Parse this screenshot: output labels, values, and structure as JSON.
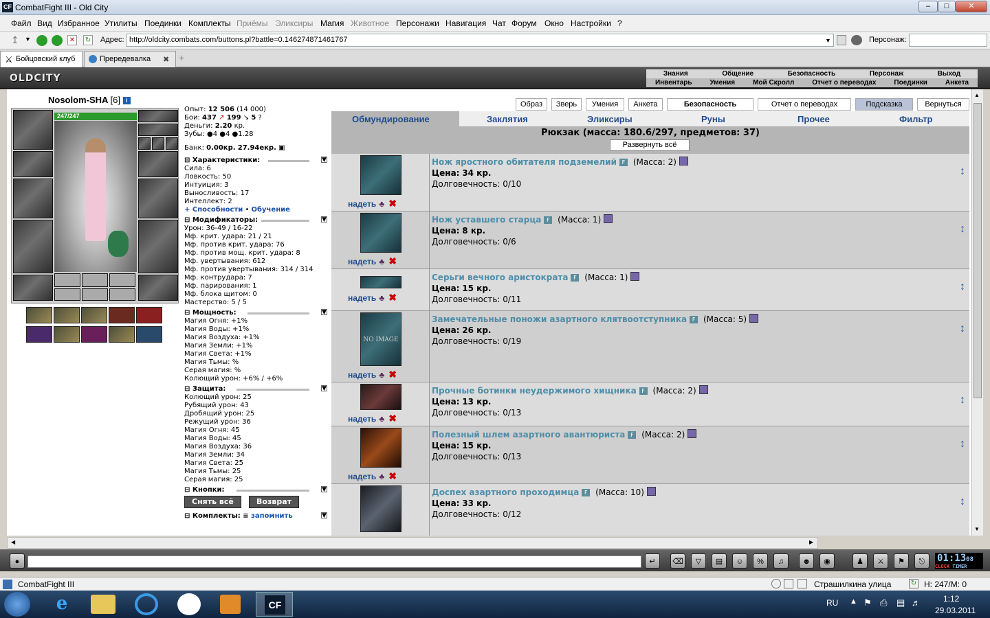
{
  "window": {
    "title": "CombatFight III - Old City",
    "icon": "CF"
  },
  "menu": {
    "items": [
      {
        "label": "Файл",
        "enabled": true
      },
      {
        "label": "Вид",
        "enabled": true
      },
      {
        "label": "Избранное",
        "enabled": true
      },
      {
        "label": "Утилиты",
        "enabled": true
      },
      {
        "label": "Поединки",
        "enabled": true
      },
      {
        "label": "Комплекты",
        "enabled": true
      },
      {
        "label": "Приёмы",
        "enabled": false
      },
      {
        "label": "Эликсиры",
        "enabled": false
      },
      {
        "label": "Магия",
        "enabled": true
      },
      {
        "label": "Животное",
        "enabled": false
      },
      {
        "label": "Персонажи",
        "enabled": true
      },
      {
        "label": "Навигация",
        "enabled": true
      },
      {
        "label": "Чат",
        "enabled": true
      },
      {
        "label": "Форум",
        "enabled": true
      },
      {
        "label": "Окно",
        "enabled": true
      },
      {
        "label": "Настройки",
        "enabled": true
      },
      {
        "label": "?",
        "enabled": true
      }
    ]
  },
  "addressbar": {
    "label": "Адрес:",
    "url": "http://oldcity.combats.com/buttons.pl?battle=0.146274871461767",
    "person_label": "Персонаж:"
  },
  "tabs": [
    {
      "label": "Бойцовский клуб",
      "active": true
    },
    {
      "label": "Прередевалка",
      "active": false
    }
  ],
  "game_header": {
    "logo": "OLDCITY",
    "nav_row1": [
      "Знания",
      "Общение",
      "Безопасность",
      "Персонаж",
      "Выход"
    ],
    "nav_row2": [
      "Инвентарь",
      "Умения",
      "Мой Скролл",
      "Отчет о переводах",
      "Поединки",
      "Анкета"
    ]
  },
  "character": {
    "name": "Nosolom-SHA",
    "level": "[6]",
    "hp": "247/247",
    "exp": {
      "label": "Опыт:",
      "value": "12 506",
      "next": "(14 000)"
    },
    "fights": {
      "label": "Бои:",
      "wins": "437",
      "losses": "199",
      "draws": "5"
    },
    "money": {
      "label": "Деньги:",
      "value": "2.20",
      "unit": "кр."
    },
    "teeth": {
      "label": "Зубы:",
      "a": "4",
      "b": "4",
      "c": "1.28"
    },
    "bank": {
      "label": "Банк:",
      "kr": "0.00кр.",
      "ekr": "27.94екр."
    }
  },
  "stats_sections": {
    "characteristics": {
      "title": "Характеристики:",
      "lines": [
        "Сила: 6",
        "Ловкость: 50",
        "Интуиция: 3",
        "Выносливость: 17",
        "Интеллект: 2"
      ]
    },
    "abilities_link": "+ Способности",
    "training_link": "Обучение",
    "modifiers": {
      "title": "Модификаторы:",
      "lines": [
        "Урон: 36-49 / 16-22",
        "Мф. крит. удара: 21 / 21",
        "Мф. против крит. удара: 76",
        "Мф. против мощ. крит. удара: 8",
        "Мф. увертывания: 612",
        "Мф. против увертывания: 314 / 314",
        "Мф. контрудара: 7",
        "Мф. парирования: 1",
        "Мф. блока щитом: 0",
        "Мастерство: 5 / 5"
      ]
    },
    "powers": {
      "title": "Мощность:",
      "lines": [
        "Магия Огня: +1%",
        "Магия Воды: +1%",
        "Магия Воздуха: +1%",
        "Магия Земли: +1%",
        "Магия Света: +1%",
        "Магия Тьмы: %",
        "Серая магия: %",
        "Колющий урон: +6% / +6%"
      ]
    },
    "protection": {
      "title": "Защита:",
      "lines": [
        "Колющий урон: 25",
        "Рубящий урон: 43",
        "Дробящий урон: 25",
        "Режущий урон: 36",
        "Магия Огня: 45",
        "Магия Воды: 45",
        "Магия Воздуха: 36",
        "Магия Земли: 34",
        "Магия Света: 25",
        "Магия Тьмы: 25",
        "Серая магия: 25"
      ]
    },
    "buttons": {
      "title": "Кнопки:",
      "remove_all": "Снять всё",
      "return": "Возврат"
    },
    "sets": {
      "title": "Комплекты:",
      "remember": "запомнить"
    }
  },
  "top_buttons": [
    "Образ",
    "Зверь",
    "Умения",
    "Анкета",
    "Безопасность",
    "Отчет о переводах",
    "Подсказка",
    "Вернуться"
  ],
  "category_tabs": [
    "Обмундирование",
    "Заклятия",
    "Эликсиры",
    "Руны",
    "Прочее",
    "Фильтр"
  ],
  "inventory": {
    "title": "Рюкзак (масса: 180.6/297, предметов: 37)",
    "expand_label": "Развернуть всё",
    "wear_label": "надеть",
    "price_label": "Цена:",
    "durability_label": "Долговечность:",
    "items": [
      {
        "name": "Нож яростного обитателя подземелий",
        "mass": "(Масса: 2)",
        "price": "34 кр.",
        "durability": "0/10"
      },
      {
        "name": "Нож уставшего старца",
        "mass": "(Масса: 1)",
        "price": "8 кр.",
        "durability": "0/6"
      },
      {
        "name": "Серьги вечного аристократа",
        "mass": "(Масса: 1)",
        "price": "15 кр.",
        "durability": "0/11"
      },
      {
        "name": "Замечательные поножи азартного клятвоотступника",
        "mass": "(Масса: 5)",
        "price": "26 кр.",
        "durability": "0/19",
        "image_text": "NO IMAGE"
      },
      {
        "name": "Прочные ботинки неудержимого хищника",
        "mass": "(Масса: 2)",
        "price": "13 кр.",
        "durability": "0/13"
      },
      {
        "name": "Полезный шлем азартного авантюриста",
        "mass": "(Масса: 2)",
        "price": "15 кр.",
        "durability": "0/13"
      },
      {
        "name": "Доспех азартного проходимца",
        "mass": "(Масса: 10)",
        "price": "33 кр.",
        "durability": "0/12"
      }
    ]
  },
  "clock": {
    "time": "01:13",
    "seconds": "08",
    "label1": "CLOCK",
    "label2": "TIMER"
  },
  "statusbar": {
    "app": "CombatFight III",
    "location": "Страшилкина улица",
    "hp": "H: 247/M: 0"
  },
  "taskbar": {
    "lang": "RU",
    "time": "1:12",
    "date": "29.03.2011"
  }
}
